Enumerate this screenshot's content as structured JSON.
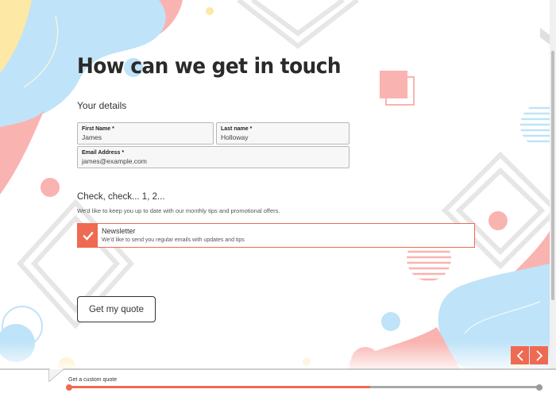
{
  "page": {
    "title": "How can we get in touch"
  },
  "details_section": {
    "label": "Your details",
    "first_name": {
      "label": "First Name *",
      "value": "James"
    },
    "last_name": {
      "label": "Last name *",
      "value": "Holloway"
    },
    "email": {
      "label": "Email Address *",
      "value": "james@example.com"
    }
  },
  "consent_section": {
    "label": "Check, check... 1, 2...",
    "description": "We'd like to keep you up to date with our monthly tips and promotional offers.",
    "newsletter": {
      "title": "Newsletter",
      "description": "We'd like to send you regular emails with updates and tips",
      "checked": true
    }
  },
  "actions": {
    "submit_label": "Get my quote"
  },
  "progress": {
    "label": "Get a custom quote",
    "fraction": 0.64
  },
  "colors": {
    "accent": "#ef6a52",
    "blob_blue": "#bfe3f8",
    "blob_pink": "#f9b3b0",
    "blob_yellow": "#fde8a6"
  },
  "icons": {
    "check": "check-icon",
    "prev": "chevron-left-icon",
    "next": "chevron-right-icon"
  }
}
